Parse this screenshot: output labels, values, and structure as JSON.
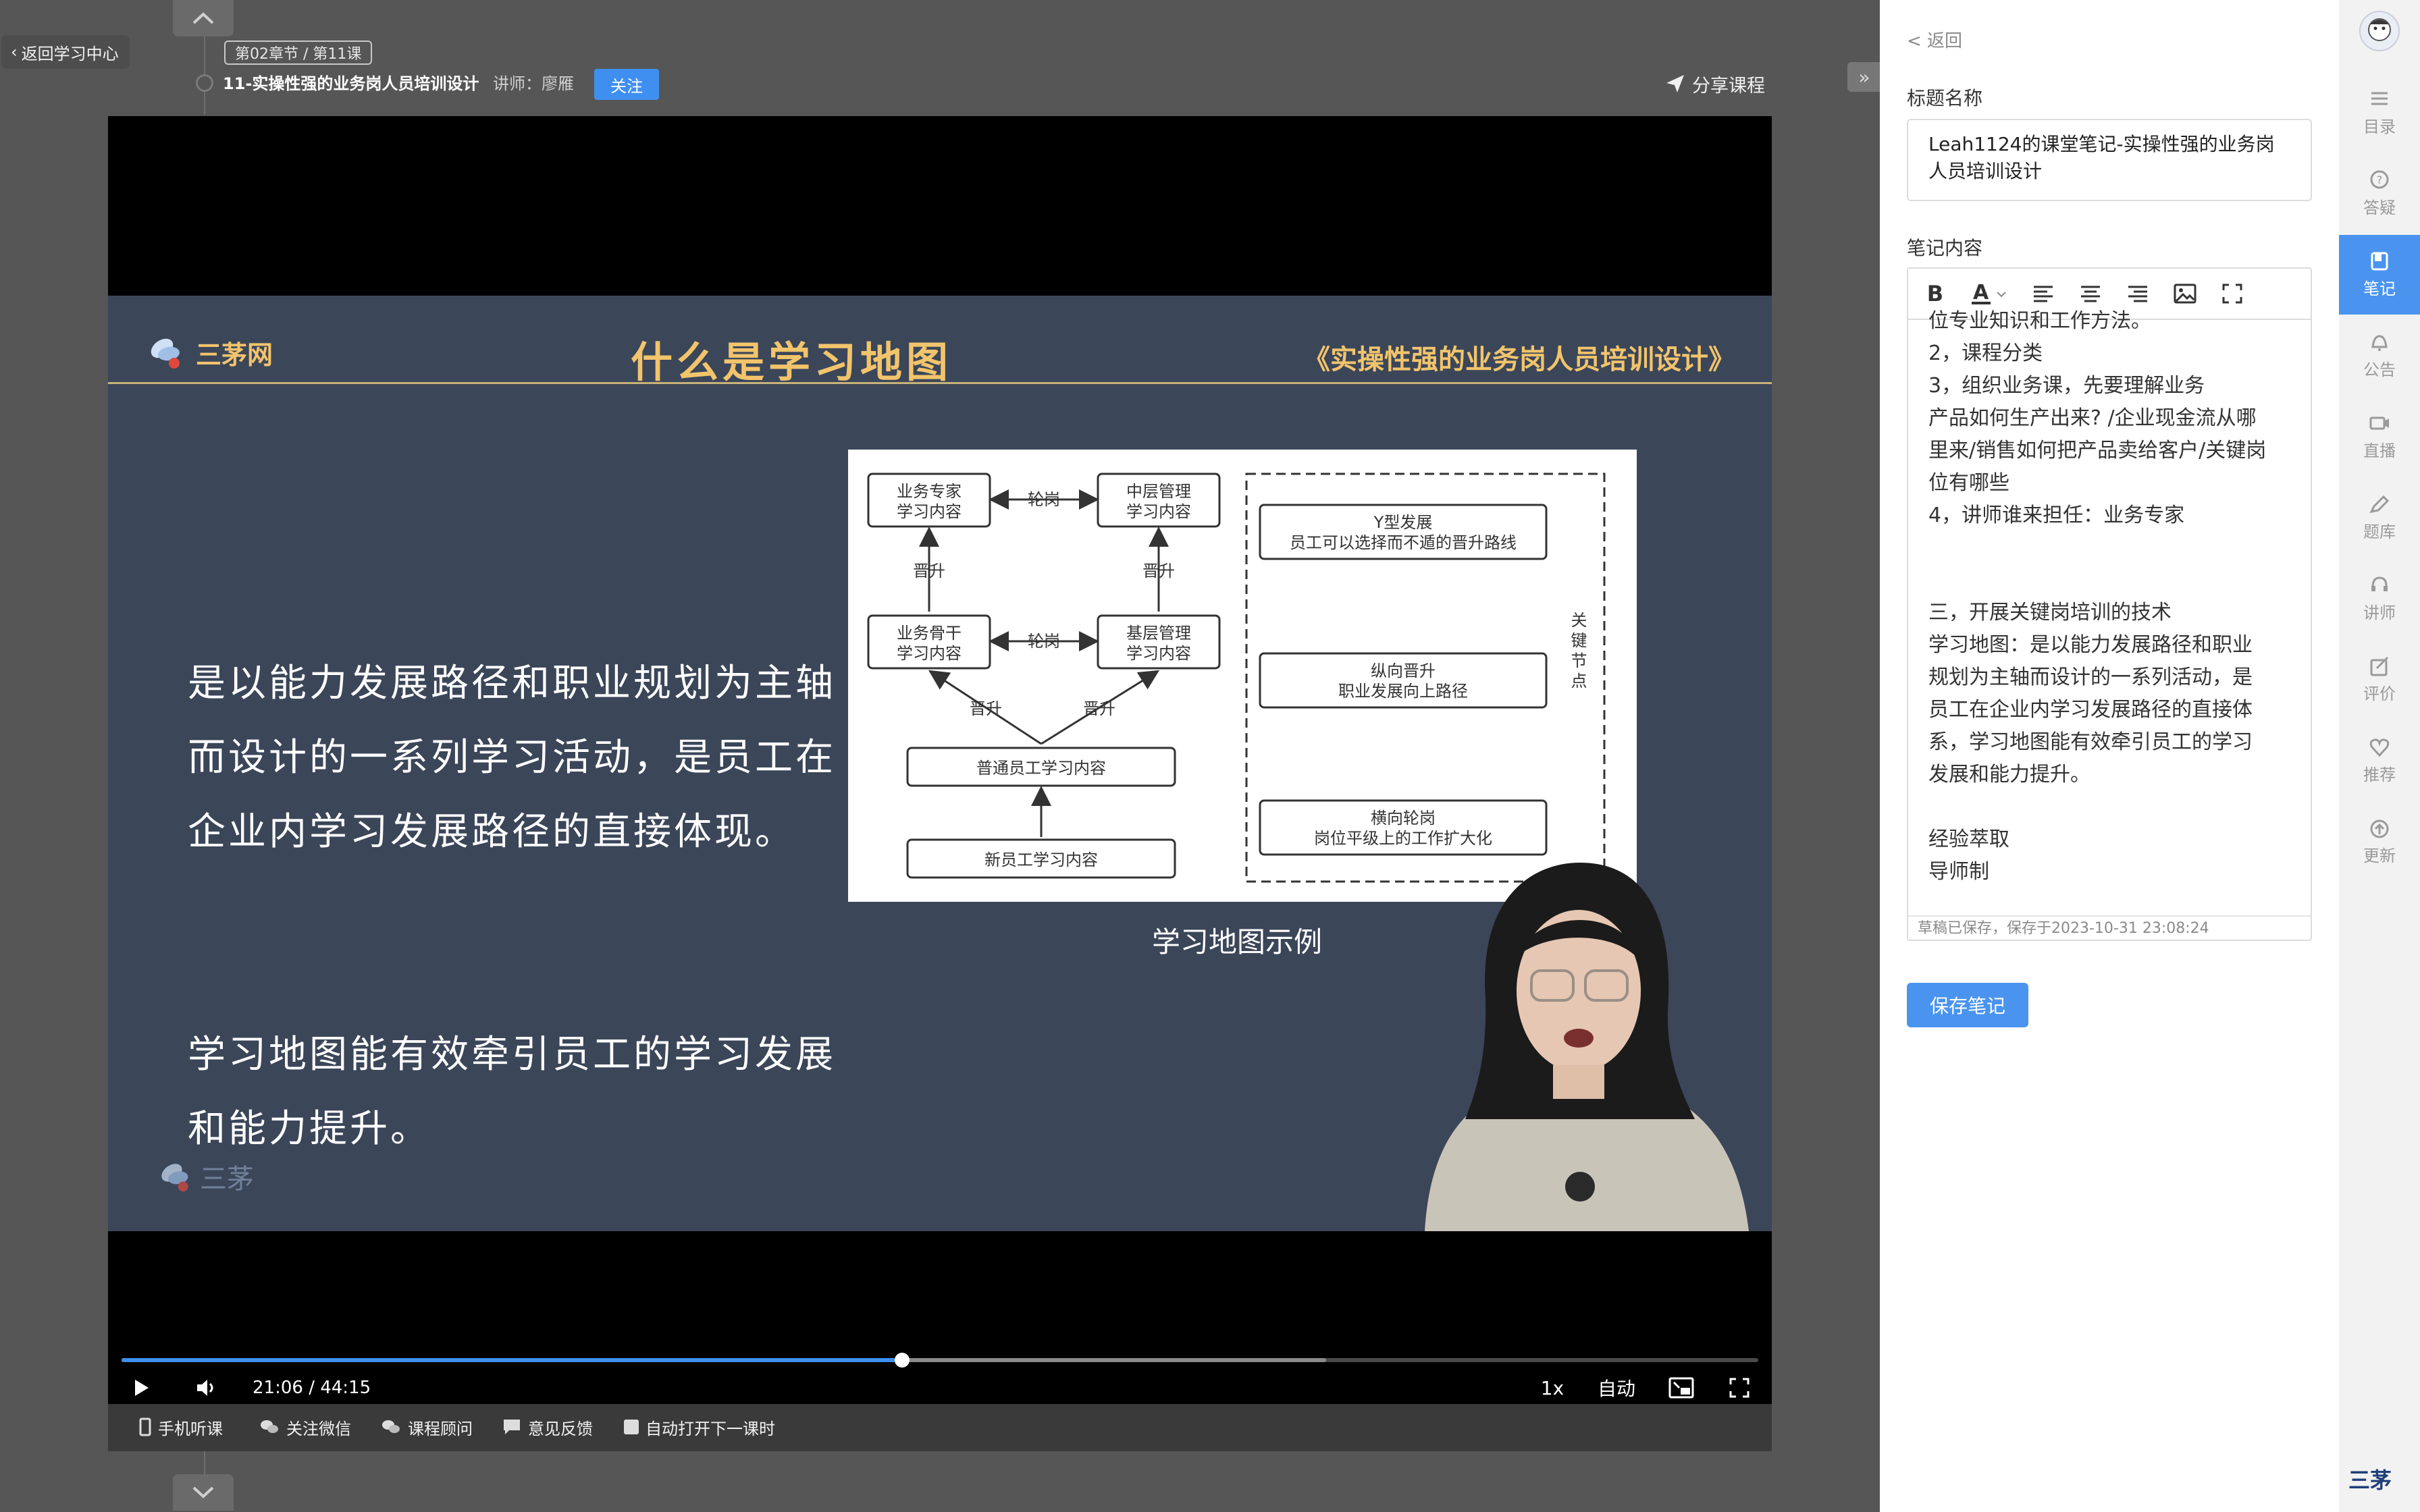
{
  "header": {
    "back_label": "返回学习中心",
    "chapter_badge": "第02章节 / 第11课",
    "lesson_title": "11-实操性强的业务岗人员培训设计",
    "teacher": "讲师：廖雁",
    "follow_label": "关注",
    "share_label": "分享课程"
  },
  "slide": {
    "logo_text": "三茅网",
    "title": "什么是学习地图",
    "course_title": "《实操性强的业务岗人员培训设计》",
    "paragraph1": "是以能力发展路径和职业规划为主轴而设计的一系列学习活动，是员工在企业内学习发展路径的直接体现。",
    "paragraph2": "学习地图能有效牵引员工的学习发展和能力提升。",
    "diagram_caption": "学习地图示例",
    "watermark": "三茅",
    "diagram": {
      "boxes": {
        "expert": [
          "业务专家",
          "学习内容"
        ],
        "middle": [
          "中层管理",
          "学习内容"
        ],
        "backbone": [
          "业务骨干",
          "学习内容"
        ],
        "base": [
          "基层管理",
          "学习内容"
        ],
        "normal": "普通员工学习内容",
        "new": "新员工学习内容",
        "y_dev": [
          "Y型发展",
          "员工可以选择而不遁的晋升路线"
        ],
        "vertical": [
          "纵向晋升",
          "职业发展向上路径"
        ],
        "horizontal": [
          "横向轮岗",
          "岗位平级上的工作扩大化"
        ]
      },
      "rotate_label": "轮岗",
      "promote_label": "晋升",
      "key_nodes": "关键节点"
    }
  },
  "player": {
    "time": "21:06 / 44:15",
    "progress": 0.477,
    "buffered": 0.736,
    "speed": "1x",
    "quality": "自动"
  },
  "bottom_bar": {
    "items": [
      "手机听课",
      "关注微信",
      "课程顾问",
      "意见反馈",
      "自动打开下一课时"
    ]
  },
  "panel": {
    "back_label": "< 返回",
    "title_label": "标题名称",
    "title_value": "Leah1124的课堂笔记-实操性强的业务岗人员培训设计",
    "content_label": "笔记内容",
    "note_lines": [
      "位专业知识和工作方法。",
      "2，课程分类",
      "3，组织业务课，先要理解业务",
      "产品如何生产出来? /企业现金流从哪",
      "里来/销售如何把产品卖给客户/关键岗",
      "位有哪些",
      "4，讲师谁来担任：业务专家",
      "",
      "",
      "三，开展关键岗培训的技术",
      "学习地图：是以能力发展路径和职业",
      "规划为主轴而设计的一系列活动，是",
      "员工在企业内学习发展路径的直接体",
      "系，学习地图能有效牵引员工的学习",
      "发展和能力提升。",
      "",
      "经验萃取",
      "导师制"
    ],
    "draft_status": "草稿已保存，保存于2023-10-31 23:08:24",
    "save_label": "保存笔记"
  },
  "sidebar": {
    "items": [
      {
        "label": "目录",
        "icon": "list-icon"
      },
      {
        "label": "答疑",
        "icon": "question-icon"
      },
      {
        "label": "笔记",
        "icon": "note-icon"
      },
      {
        "label": "公告",
        "icon": "bell-icon"
      },
      {
        "label": "直播",
        "icon": "live-icon"
      },
      {
        "label": "题库",
        "icon": "edit-icon"
      },
      {
        "label": "讲师",
        "icon": "teacher-icon"
      },
      {
        "label": "评价",
        "icon": "rate-icon"
      },
      {
        "label": "推荐",
        "icon": "heart-icon"
      },
      {
        "label": "更新",
        "icon": "update-icon"
      }
    ],
    "active": "笔记",
    "corner_logo": "三茅"
  },
  "colors": {
    "accent": "#4a94f0",
    "slide_bg": "#3b4659",
    "slide_title": "#f2c46b"
  }
}
